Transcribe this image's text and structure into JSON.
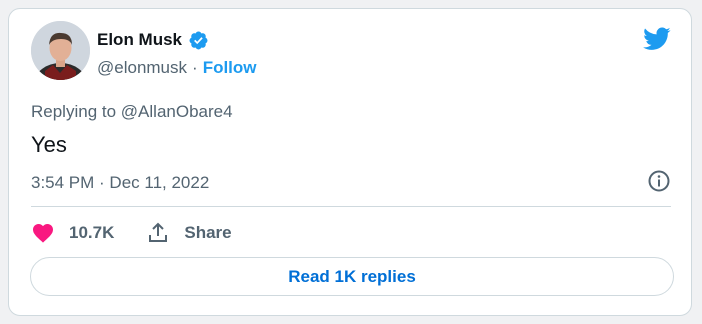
{
  "tweet": {
    "author": {
      "display_name": "Elon Musk",
      "handle": "@elonmusk",
      "separator": "·",
      "follow_label": "Follow",
      "verified": true
    },
    "replying_prefix": "Replying to",
    "replying_to": "@AllanObare4",
    "text": "Yes",
    "timestamp": "3:54 PM · Dec 11, 2022",
    "actions": {
      "like_count": "10.7K",
      "share_label": "Share"
    },
    "read_replies_label": "Read 1K replies"
  },
  "colors": {
    "accent": "#1d9bf0",
    "like": "#f91880",
    "link": "#006fd6",
    "muted": "#536471",
    "border": "#cfd9de"
  },
  "icons": [
    "verified-badge-icon",
    "twitter-bird-icon",
    "info-icon",
    "heart-icon",
    "share-icon"
  ]
}
